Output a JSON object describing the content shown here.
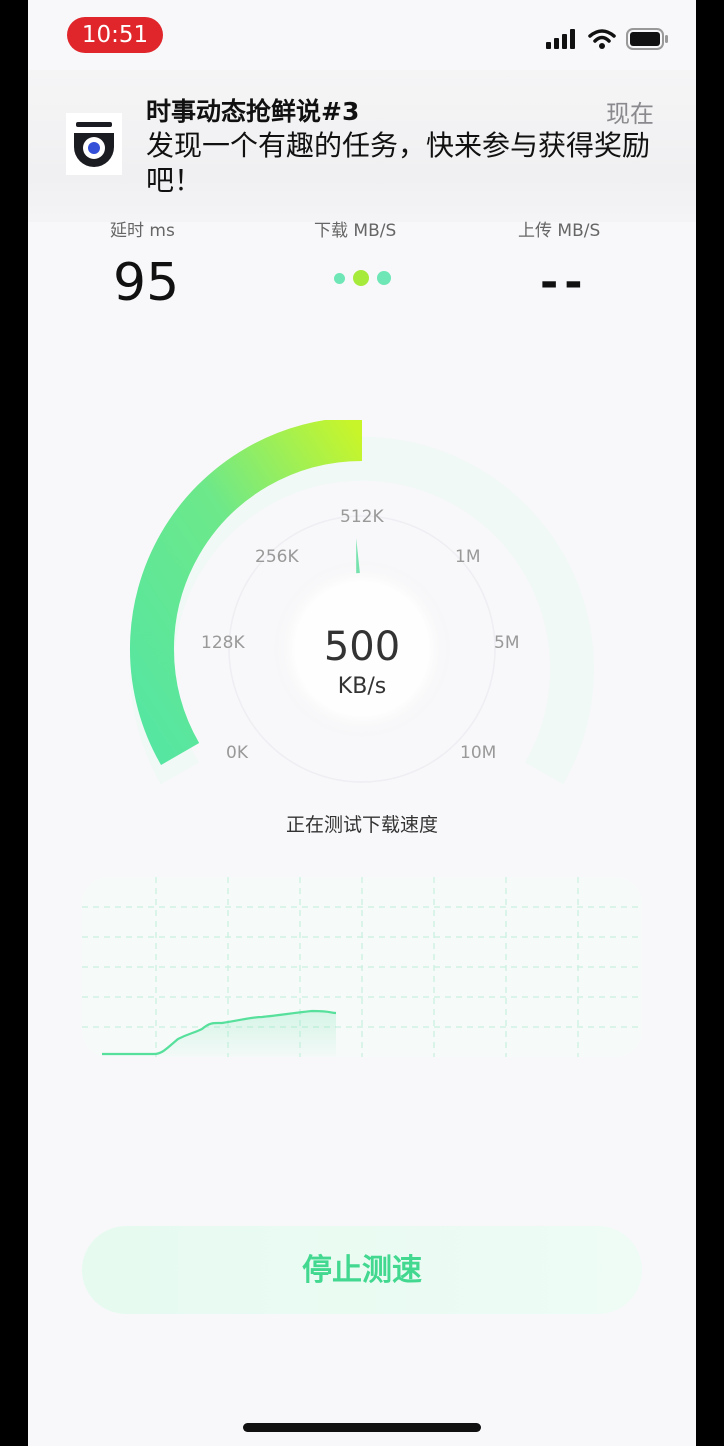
{
  "status_bar": {
    "time": "10:51"
  },
  "notification": {
    "title": "时事动态抢鲜说#3",
    "time": "现在",
    "body": "发现一个有趣的任务，快来参与获得奖励吧！"
  },
  "metrics": {
    "latency": {
      "label": "延时 ms",
      "value": "95"
    },
    "download": {
      "label": "下载 MB/S"
    },
    "upload": {
      "label": "上传 MB/S",
      "value": "--"
    }
  },
  "gauge": {
    "value": "500",
    "unit": "KB/s",
    "ticks": [
      "0K",
      "128K",
      "256K",
      "512K",
      "1M",
      "5M",
      "10M"
    ],
    "level_fraction": 0.5,
    "status": "正在测试下载速度"
  },
  "colors": {
    "accent": "#42d890",
    "accent_light": "#c8f52a",
    "alert": "#e0262b"
  },
  "actions": {
    "stop_label": "停止测速"
  }
}
